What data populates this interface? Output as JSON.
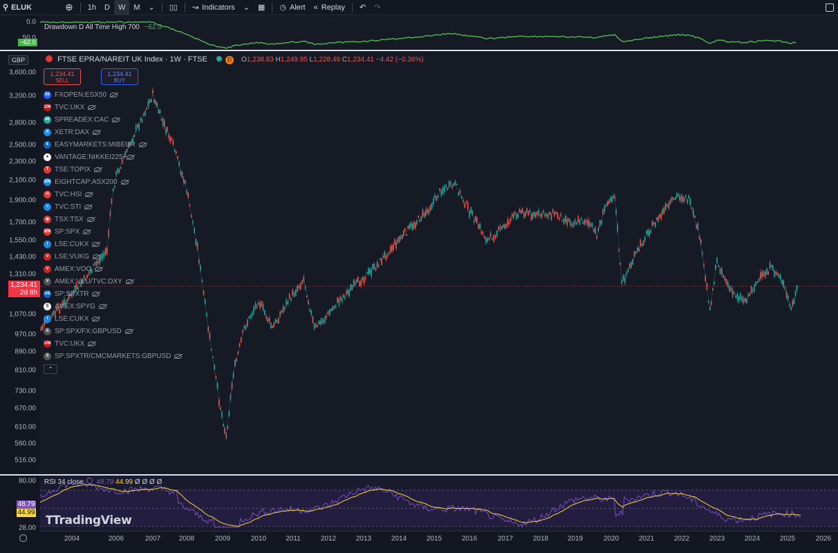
{
  "toolbar": {
    "symbol": "ELUK",
    "intervals": [
      "1h",
      "D",
      "W",
      "M"
    ],
    "active_interval": "W",
    "indicators_label": "Indicators",
    "alert_label": "Alert",
    "replay_label": "Replay"
  },
  "drawdown": {
    "title": "Drawdown D All Time High 700",
    "value": "−62.0",
    "tag": "−62.0",
    "axis": [
      "0.0",
      "50.0"
    ],
    "color": "#4caf50"
  },
  "main": {
    "currency": "GBP",
    "title": "FTSE EPRA/NAREIT UK Index · 1W · FTSE",
    "badge": "D",
    "ohlc": {
      "o_label": "O",
      "o": "1,238.83",
      "h_label": "H",
      "h": "1,249.95",
      "l_label": "L",
      "l": "1,228.49",
      "c_label": "C",
      "c": "1,234.41",
      "change": "−4.42 (−0.36%)"
    },
    "sell": {
      "price": "1,234.41",
      "label": "SELL"
    },
    "buy": {
      "price": "1,234.41",
      "label": "BUY"
    },
    "price_tag": {
      "price": "1,234.41",
      "time": "2d 8h"
    },
    "axis": [
      "3,600.00",
      "3,200.00",
      "2,800.00",
      "2,500.00",
      "2,300.00",
      "2,100.00",
      "1,900.00",
      "1,700.00",
      "1,550.00",
      "1,430.00",
      "1,310.00",
      "1,070.00",
      "970.00",
      "890.00",
      "810.00",
      "730.00",
      "670.00",
      "610.00",
      "560.00",
      "516.00"
    ],
    "symbols": [
      {
        "badge": "50",
        "name": "FXOPEN:ESX50",
        "color": "#2962ff"
      },
      {
        "badge": "100",
        "name": "TVC:UKX",
        "color": "#b71c1c"
      },
      {
        "badge": "40",
        "name": "SPREADEX:CAC",
        "color": "#26a69a"
      },
      {
        "badge": "X",
        "name": "XETR:DAX",
        "color": "#1e88e5"
      },
      {
        "badge": "€",
        "name": "EASYMARKETS:MIBEUR",
        "color": "#1565c0"
      },
      {
        "badge": "●",
        "name": "VANTAGE:NIKKEI225",
        "color": "#ffffff"
      },
      {
        "badge": "T",
        "name": "TSE:TOPIX",
        "color": "#e53935"
      },
      {
        "badge": "200",
        "name": "EIGHTCAP:ASX200",
        "color": "#1e88e5"
      },
      {
        "badge": "H",
        "name": "TVC:HSI",
        "color": "#e53935"
      },
      {
        "badge": "≡",
        "name": "TVC:STI",
        "color": "#1e88e5"
      },
      {
        "badge": "✱",
        "name": "TSX:TSX",
        "color": "#e53935"
      },
      {
        "badge": "500",
        "name": "SP:SPX",
        "color": "#e53935"
      },
      {
        "badge": "i",
        "name": "LSE:CUKX",
        "color": "#1e88e5"
      },
      {
        "badge": "V",
        "name": "LSE:VUKG",
        "color": "#c62828"
      },
      {
        "badge": "V",
        "name": "AMEX:VOO",
        "color": "#c62828"
      },
      {
        "badge": "V",
        "name": "AMEX:VEU/TVC:DXY",
        "color": "#555"
      },
      {
        "badge": "US",
        "name": "SP:SPXTR",
        "color": "#1565c0"
      },
      {
        "badge": "S",
        "name": "AMEX:SPYG",
        "color": "#ffffff"
      },
      {
        "badge": "i",
        "name": "LSE:CUKX",
        "color": "#1e88e5"
      },
      {
        "badge": "S",
        "name": "SP:SPX/FX:GBPUSD",
        "color": "#555"
      },
      {
        "badge": "100",
        "name": "TVC:UKX",
        "color": "#b71c1c"
      },
      {
        "badge": "S",
        "name": "SP:SPXTR/CMCMARKETS:GBPUSD",
        "color": "#555"
      }
    ]
  },
  "rsi": {
    "title": "RSI 34 close",
    "value1": "48.79",
    "value2": "44.99",
    "placeholders": "Ø Ø Ø Ø",
    "axis": [
      "80.00",
      "28.00"
    ],
    "tag1": "48.79",
    "tag2": "44.99",
    "line_color": "#7e57c2",
    "ma_color": "#fdd835"
  },
  "logo": "TradingView",
  "time_axis": [
    "2004",
    "2006",
    "2007",
    "2008",
    "2009",
    "2010",
    "2011",
    "2012",
    "2013",
    "2014",
    "2015",
    "2016",
    "2017",
    "2018",
    "2019",
    "2020",
    "2021",
    "2022",
    "2023",
    "2024",
    "2025",
    "2026"
  ],
  "chart_data": {
    "type": "line",
    "title": "FTSE EPRA/NAREIT UK Index · 1W · FTSE",
    "xlabel": "",
    "ylabel": "",
    "scale": "log",
    "ylim": [
      516,
      3600
    ],
    "x": [
      2003.0,
      2004.0,
      2005.0,
      2005.5,
      2006.0,
      2006.5,
      2007.0,
      2007.3,
      2007.6,
      2008.0,
      2008.3,
      2008.6,
      2008.9,
      2009.1,
      2009.3,
      2009.6,
      2010.0,
      2010.4,
      2010.8,
      2011.3,
      2011.6,
      2011.9,
      2012.3,
      2012.8,
      2013.3,
      2013.8,
      2014.3,
      2014.8,
      2015.2,
      2015.6,
      2016.0,
      2016.5,
      2016.9,
      2017.4,
      2017.9,
      2018.4,
      2018.9,
      2019.3,
      2019.6,
      2019.9,
      2020.1,
      2020.3,
      2020.7,
      2021.0,
      2021.5,
      2021.9,
      2022.2,
      2022.5,
      2022.8,
      2023.0,
      2023.4,
      2023.8,
      2024.1,
      2024.5,
      2024.8,
      2025.1,
      2025.3
    ],
    "values": [
      980,
      1180,
      1480,
      1900,
      2150,
      2650,
      3220,
      2800,
      2500,
      2000,
      1500,
      1000,
      700,
      580,
      800,
      1000,
      1150,
      1000,
      1130,
      1280,
      1000,
      1050,
      1150,
      1250,
      1350,
      1500,
      1650,
      1800,
      2000,
      2050,
      1800,
      1550,
      1650,
      1800,
      1760,
      1780,
      1700,
      1720,
      1600,
      1900,
      1950,
      1250,
      1450,
      1600,
      1800,
      1950,
      1900,
      1600,
      1100,
      1400,
      1200,
      1150,
      1250,
      1350,
      1300,
      1100,
      1234
    ]
  }
}
